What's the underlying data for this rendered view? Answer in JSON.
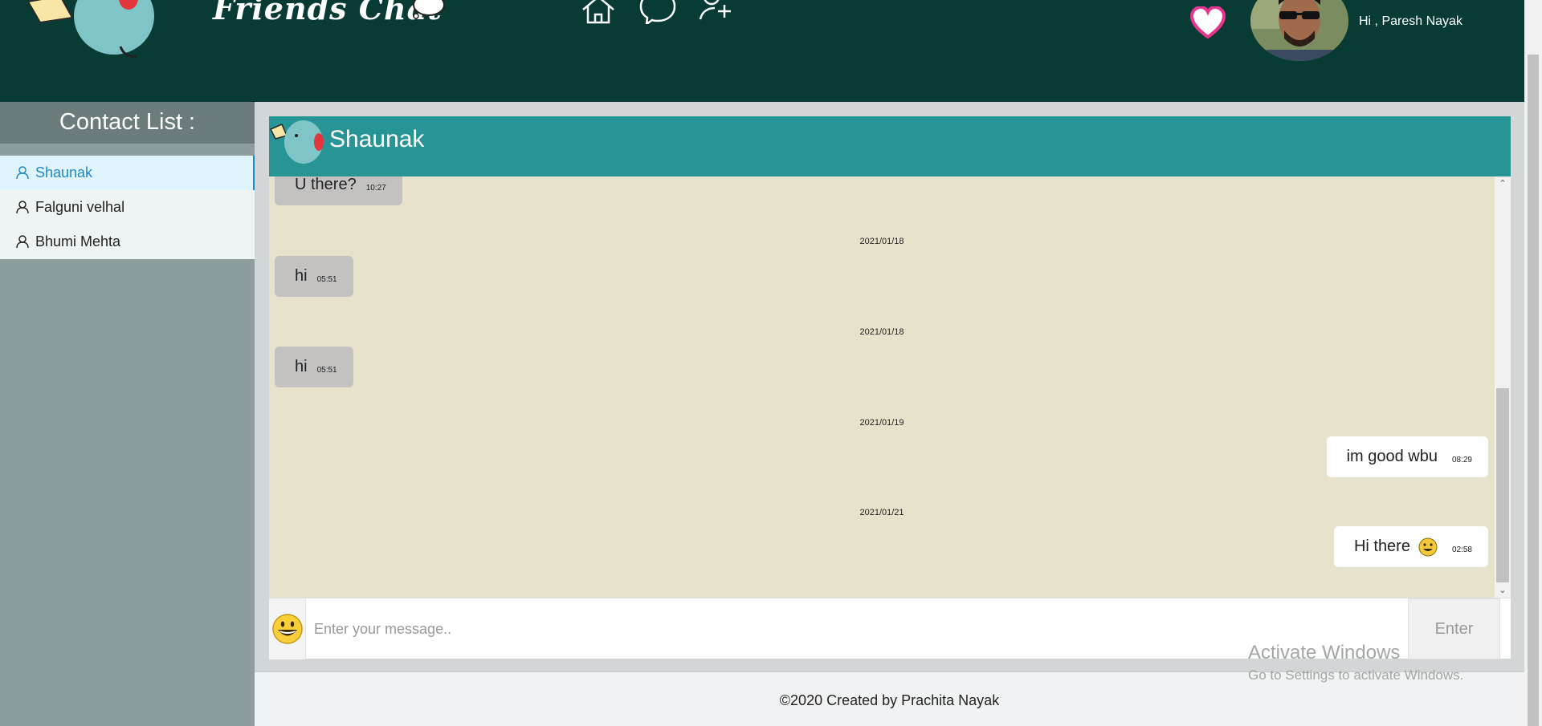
{
  "header": {
    "brand_title": "Friends Chat",
    "greeting": "Hi , Paresh Nayak",
    "nav": [
      "home-icon",
      "messenger-icon",
      "add-friend-icon"
    ],
    "colors": {
      "header_bg": "#093b35",
      "heart": "#e8358f"
    }
  },
  "sidebar": {
    "title": "Contact List :",
    "contacts": [
      {
        "name": "Shaunak",
        "active": true
      },
      {
        "name": "Falguni velhal",
        "active": false
      },
      {
        "name": "Bhumi Mehta",
        "active": false
      }
    ]
  },
  "chat": {
    "contact_name": "Shaunak",
    "header_color": "#279496",
    "background_color": "#e7e2cb",
    "messages": [
      {
        "direction": "in",
        "text": "U there?",
        "time": "10:27"
      },
      {
        "date": "2021/01/18"
      },
      {
        "direction": "in",
        "text": "hi",
        "time": "05:51"
      },
      {
        "date": "2021/01/18"
      },
      {
        "direction": "in",
        "text": "hi",
        "time": "05:51"
      },
      {
        "date": "2021/01/19"
      },
      {
        "direction": "out",
        "text": "im good wbu",
        "time": "08:29"
      },
      {
        "date": "2021/01/21"
      },
      {
        "direction": "out",
        "text": "Hi there",
        "emoji": "smiley-icon",
        "time": "02:58"
      }
    ]
  },
  "input": {
    "placeholder": "Enter your message..",
    "value": "",
    "send_label": "Enter"
  },
  "footer": {
    "text": "©2020 Created by Prachita Nayak"
  },
  "watermark": {
    "line1": "Activate Windows",
    "line2": "Go to Settings to activate Windows."
  }
}
